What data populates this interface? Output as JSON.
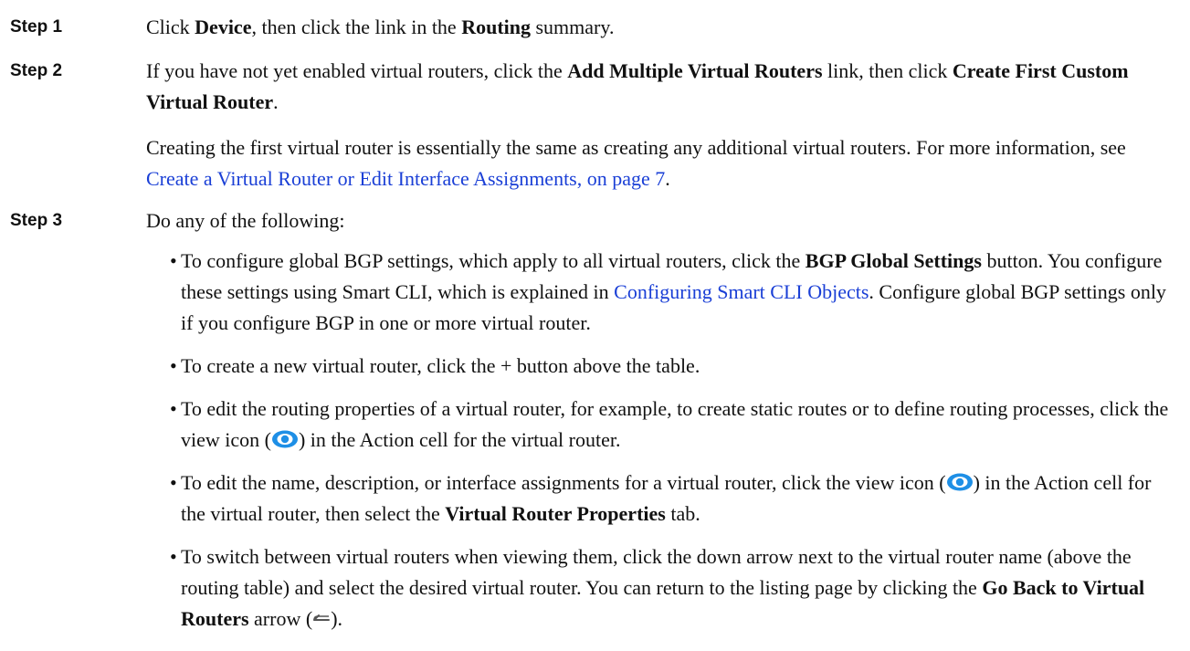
{
  "steps": [
    {
      "label": "Step 1",
      "text_a": "Click ",
      "b1": "Device",
      "text_b": ", then click the link in the ",
      "b2": "Routing",
      "text_c": " summary."
    },
    {
      "label": "Step 2",
      "text_a": "If you have not yet enabled virtual routers, click the ",
      "b1": "Add Multiple Virtual Routers",
      "text_b": " link, then click ",
      "b2": "Create First Custom Virtual Router",
      "text_c": ".",
      "note_a": "Creating the first virtual router is essentially the same as creating any additional virtual routers. For more information, see ",
      "note_link": "Create a Virtual Router or Edit Interface Assignments, on page 7",
      "note_b": "."
    },
    {
      "label": "Step 3",
      "intro": "Do any of the following:"
    }
  ],
  "bullets": [
    {
      "dot": "•",
      "t1": "To configure global BGP settings, which apply to all virtual routers, click the ",
      "b1": "BGP Global Settings",
      "t2": " button. You configure these settings using Smart CLI, which is explained in ",
      "link": "Configuring Smart CLI Objects",
      "t3": ". Configure global BGP settings only if you configure BGP in one or more virtual router."
    },
    {
      "dot": "•",
      "t1": "To create a new virtual router, click the + button above the table."
    },
    {
      "dot": "•",
      "t1": "To edit the routing properties of a virtual router, for example, to create static routes or to define routing processes, click the view icon (",
      "t2": ") in the Action cell for the virtual router."
    },
    {
      "dot": "•",
      "t1": "To edit the name, description, or interface assignments for a virtual router, click the view icon (",
      "t2": ") in the Action cell for the virtual router, then select the ",
      "b1": "Virtual Router Properties",
      "t3": " tab."
    },
    {
      "dot": "•",
      "t1": "To switch between virtual routers when viewing them, click the down arrow next to the virtual router name (above the routing table) and select the desired virtual router. You can return to the listing page by clicking the ",
      "b1": "Go Back to Virtual Routers",
      "t2": " arrow (",
      "t3": ")."
    }
  ],
  "icons": {
    "view": "eye-icon",
    "back": "back-arrow-icon"
  },
  "colors": {
    "link": "#1a3fd6",
    "view_icon": "#1e8fe6"
  }
}
